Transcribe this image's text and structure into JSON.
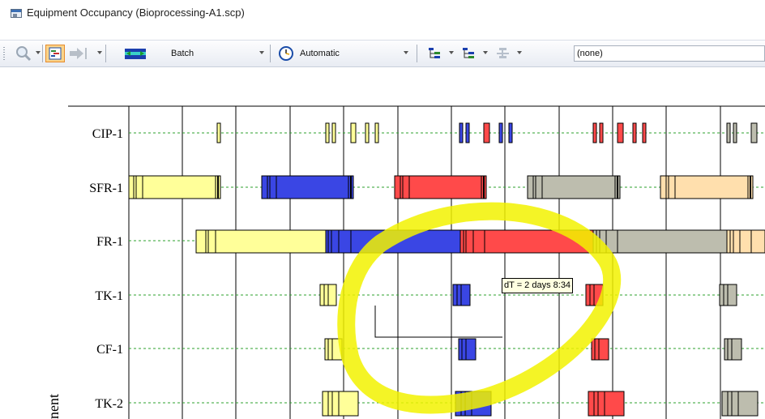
{
  "window": {
    "title": "Equipment Occupancy (Bioprocessing-A1.scp)",
    "icon": "window-app-icon"
  },
  "toolbar": {
    "zoom_icon": "magnifier-icon",
    "view_icon": "chart-view-icon",
    "next_icon": "arrow-to-bar-icon",
    "batch_icon": "batch-span-icon",
    "batch_label": "Batch",
    "clock_icon": "clock-icon",
    "mode_label": "Automatic",
    "tree_icon_1": "hierarchy-icon",
    "tree_icon_2": "hierarchy-alt-icon",
    "tree_icon_3": "branch-icon",
    "filter_value": "(none)"
  },
  "chart": {
    "y_axis_label": "nent",
    "colors": {
      "yellow": "#ffff99",
      "blue": "#3a46e4",
      "red": "#ff4a4a",
      "gray": "#bdbdae",
      "peach": "#ffdfad",
      "highlight": "#f2f200"
    },
    "rows": [
      {
        "label": "CIP-1",
        "gridline": "green-dashed"
      },
      {
        "label": "SFR-1",
        "gridline": "green-dashed"
      },
      {
        "label": "FR-1",
        "gridline": "green-dashed"
      },
      {
        "label": "TK-1",
        "gridline": "green-dashed"
      },
      {
        "label": "CF-1",
        "gridline": "green-dashed"
      },
      {
        "label": "TK-2",
        "gridline": "green-dashed"
      }
    ],
    "tooltip": "dT = 2 days 8:34"
  }
}
